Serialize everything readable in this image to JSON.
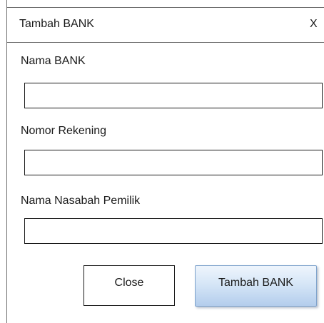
{
  "dialog": {
    "title": "Tambah BANK",
    "close_label": "X"
  },
  "form": {
    "bank_name": {
      "label": "Nama BANK",
      "value": "",
      "placeholder": ""
    },
    "account_number": {
      "label": "Nomor Rekening",
      "value": "",
      "placeholder": ""
    },
    "holder_name": {
      "label": "Nama Nasabah Pemilik",
      "value": "",
      "placeholder": ""
    }
  },
  "buttons": {
    "close_label": "Close",
    "submit_label": "Tambah BANK"
  }
}
